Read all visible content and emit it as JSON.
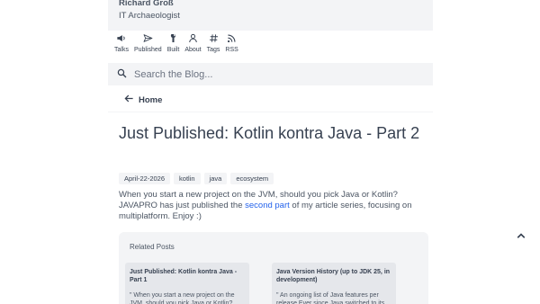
{
  "site": {
    "name": "Richard Groß",
    "subtitle": "IT Archaeologist"
  },
  "nav": [
    {
      "label": "Talks",
      "icon": "megaphone-icon"
    },
    {
      "label": "Published",
      "icon": "paper-plane-icon"
    },
    {
      "label": "Built",
      "icon": "wrench-icon"
    },
    {
      "label": "About",
      "icon": "user-icon"
    },
    {
      "label": "Tags",
      "icon": "hash-icon"
    },
    {
      "label": "RSS",
      "icon": "rss-icon"
    }
  ],
  "search": {
    "placeholder": "Search the Blog..."
  },
  "breadcrumb": {
    "home_label": "Home"
  },
  "post": {
    "title": "Just Published: Kotlin kontra Java - Part 2",
    "date": "April-22-2026",
    "tags": [
      "kotlin",
      "java",
      "ecosystem"
    ],
    "summary_before": "When you start a new project on the JVM, should you pick Java or Kotlin? JAVAPRO has just published the ",
    "summary_link": "second part",
    "summary_after": " of my article series, focusing on multiplatform. Enjoy :)"
  },
  "related": {
    "heading": "Related Posts",
    "items": [
      {
        "title": "Just Published: Kotlin kontra Java - Part 1",
        "excerpt": "\" When you start a new project on the JVM, should you pick Java or Kotlin? JAVAPRO has"
      },
      {
        "title": "Java Version History (up to JDK 25, in development)",
        "excerpt": "\" An ongoing list of Java features per release Ever since Java switched to its six-month"
      }
    ]
  },
  "colors": {
    "accent_link": "#2563eb",
    "panel_bg": "#f3f4f6",
    "text": "#374151"
  }
}
